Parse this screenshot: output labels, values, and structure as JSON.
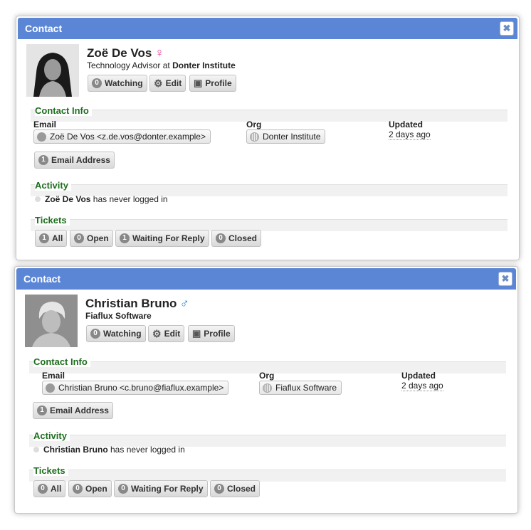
{
  "contacts": [
    {
      "header_title": "Contact",
      "close_label": "✖",
      "name": "Zoë De Vos",
      "gender_symbol": "♀",
      "gender_color": "#e0449a",
      "title_text": "Technology Advisor at ",
      "company": "Donter Institute",
      "actions": {
        "watching_count": "0",
        "watching_label": "Watching",
        "edit_label": "Edit",
        "profile_label": "Profile"
      },
      "contact_info": {
        "section_title": "Contact Info",
        "email_label": "Email",
        "email_value": "Zoë De Vos <z.de.vos@donter.example>",
        "org_label": "Org",
        "org_value": "Donter Institute",
        "updated_label": "Updated",
        "updated_value": "2 days ago",
        "email_address_count": "1",
        "email_address_label": "Email Address"
      },
      "activity": {
        "section_title": "Activity",
        "name": "Zoë De Vos",
        "text": " has never logged in"
      },
      "tickets": {
        "section_title": "Tickets",
        "all_count": "1",
        "all_label": "All",
        "open_count": "0",
        "open_label": "Open",
        "waiting_count": "1",
        "waiting_label": "Waiting For Reply",
        "closed_count": "0",
        "closed_label": "Closed"
      }
    },
    {
      "header_title": "Contact",
      "close_label": "✖",
      "name": "Christian Bruno",
      "gender_symbol": "♂",
      "gender_color": "#2a8bd8",
      "title_text": "",
      "company": "Fiaflux Software",
      "actions": {
        "watching_count": "0",
        "watching_label": "Watching",
        "edit_label": "Edit",
        "profile_label": "Profile"
      },
      "contact_info": {
        "section_title": "Contact Info",
        "email_label": "Email",
        "email_value": "Christian Bruno <c.bruno@fiaflux.example>",
        "org_label": "Org",
        "org_value": "Fiaflux Software",
        "updated_label": "Updated",
        "updated_value": "2 days ago",
        "email_address_count": "1",
        "email_address_label": "Email Address"
      },
      "activity": {
        "section_title": "Activity",
        "name": "Christian Bruno",
        "text": " has never logged in"
      },
      "tickets": {
        "section_title": "Tickets",
        "all_count": "0",
        "all_label": "All",
        "open_count": "0",
        "open_label": "Open",
        "waiting_count": "0",
        "waiting_label": "Waiting For Reply",
        "closed_count": "0",
        "closed_label": "Closed"
      }
    }
  ]
}
